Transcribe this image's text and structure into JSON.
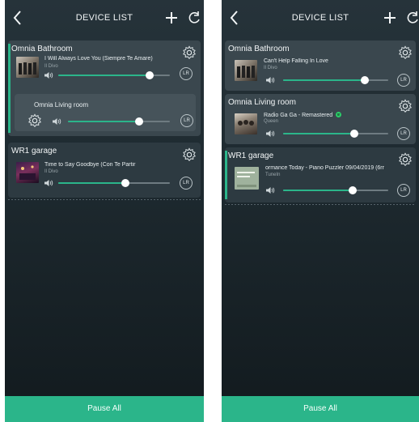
{
  "screens": [
    {
      "title": "DEVICE LIST",
      "groups": [
        {
          "name": "Omnia Bathroom",
          "track": "I Will Always Love You (Siempre Te Amare)",
          "artist": "Il Divo",
          "volume": 0.82,
          "lr": "LR",
          "sub": {
            "name": "Omnia Living room",
            "volume": 0.7,
            "lr": "LR"
          }
        },
        {
          "name": "WR1 garage",
          "track": "Time to Say Goodbye (Con Te Partir",
          "artist": "Il Divo",
          "volume": 0.6,
          "lr": "LR"
        }
      ],
      "footer": "Pause All"
    },
    {
      "title": "DEVICE LIST",
      "groups": [
        {
          "name": "Omnia Bathroom",
          "track": "Can't Help Falling In Love",
          "artist": "Il Divo",
          "volume": 0.78,
          "lr": "LR"
        },
        {
          "name": "Omnia Living room",
          "track": "Radio Ga Ga - Remastered",
          "artist": "Queen",
          "volume": 0.68,
          "lr": "LR"
        },
        {
          "name": "WR1 garage",
          "track": "ormance Today - Piano Puzzler 09/04/2019 (6rr",
          "artist": "TuneIn",
          "volume": 0.66,
          "lr": "LR"
        }
      ],
      "footer": "Pause All"
    }
  ],
  "colors": {
    "accent": "#2bb58a",
    "background": "#1e2a30",
    "card": "#3a474e"
  },
  "icons": [
    "back-icon",
    "plus-icon",
    "refresh-icon",
    "gear-icon",
    "speaker-icon"
  ]
}
